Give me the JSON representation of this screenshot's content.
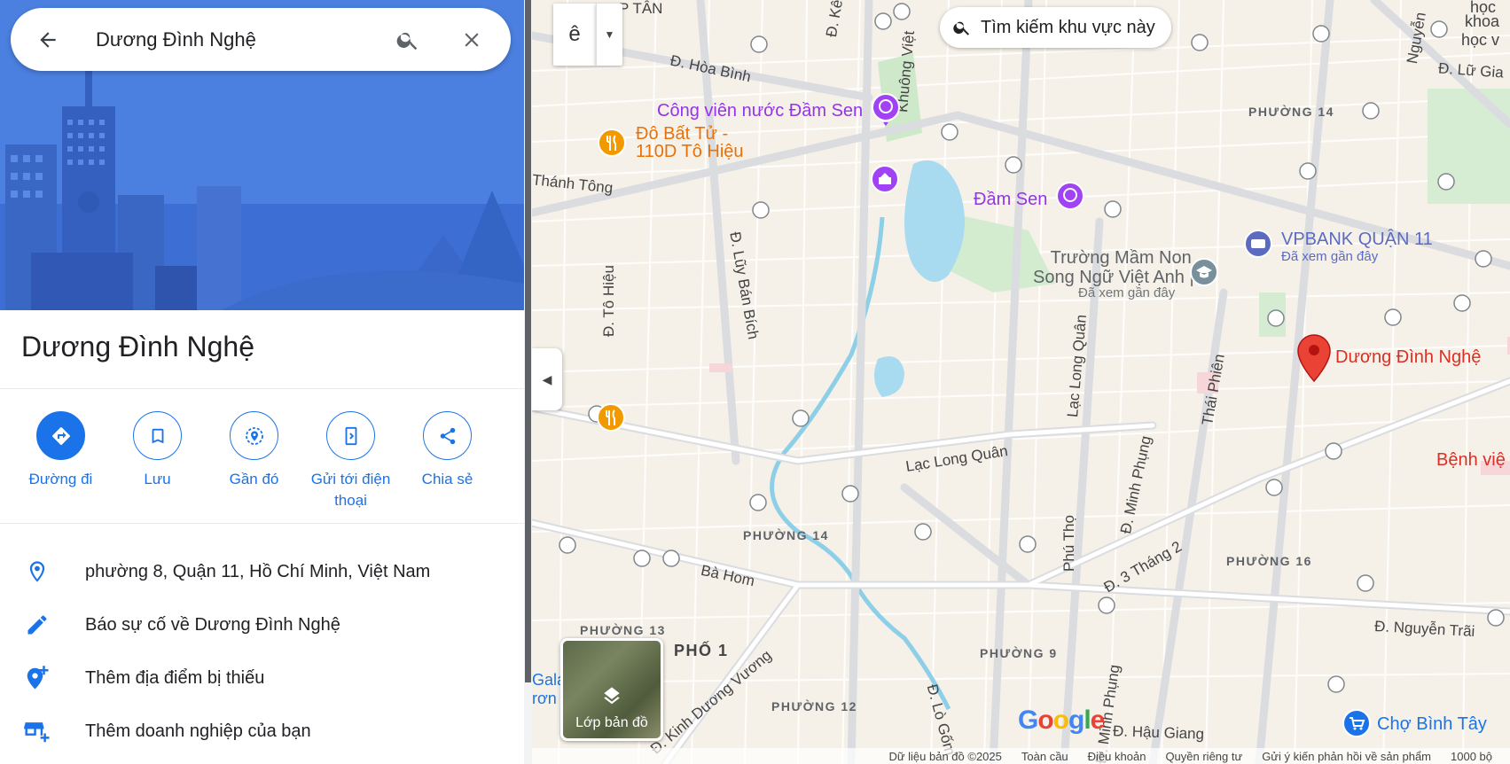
{
  "search": {
    "query": "Dương Đình Nghệ"
  },
  "place": {
    "title": "Dương Đình Nghệ"
  },
  "actions": [
    {
      "label": "Đường đi",
      "icon": "directions-icon"
    },
    {
      "label": "Lưu",
      "icon": "bookmark-icon"
    },
    {
      "label": "Gần đó",
      "icon": "nearby-icon"
    },
    {
      "label": "Gửi tới điện thoại",
      "icon": "send-to-phone-icon"
    },
    {
      "label": "Chia sẻ",
      "icon": "share-icon"
    }
  ],
  "info": {
    "address": "phường 8, Quận 11, Hồ Chí Minh, Việt Nam",
    "report": "Báo sự cố về Dương Đình Nghệ",
    "add_place": "Thêm địa điểm bị thiếu",
    "add_business": "Thêm doanh nghiệp của bạn"
  },
  "map": {
    "search_area": "Tìm kiếm khu vực này",
    "lang_char": "ê",
    "layers_label": "Lớp bản đồ",
    "selected_pin_label": "Dương Đình Nghệ",
    "pin_color": "#ea4335",
    "accent": "#1a73e8",
    "roads": {
      "hoa_binh": "Đ. Hòa Bình",
      "kenh_tan": "Đ. Kênh Tân",
      "khuong_viet": "Khuông Việt",
      "thanh_tong": "Thánh Tông",
      "to_hieu": "Đ. Tô Hiệu",
      "luy_ban_bich": "Đ. Lũy Bán Bích",
      "lac_long_quan_v": "Lạc Long Quân",
      "lac_long_quan_h": "Lạc Long Quân",
      "minh_phung": "Đ. Minh Phụng",
      "thai_phien": "Thái Phiên",
      "ba_thang_hai": "Đ. 3 Tháng 2",
      "ba_hom": "Bà Hom",
      "phu_tho": "Phú Thọ",
      "nguyen_trai": "Đ. Nguyễn Trãi",
      "hau_giang": "Đ. Hậu Giang",
      "lo_gom": "Đ. Lò Gốm",
      "kinh_duong_vuong": "Đ. Kinh Dương Vương",
      "minh_phung_2": "Đ. Minh Phụng",
      "lu_gia": "Đ. Lữ Gia",
      "nguyen": "Nguyễn",
      "p_tan": "P TÂN"
    },
    "wards": {
      "p14_top": "PHƯỜNG 14",
      "p14": "PHƯỜNG 14",
      "p16": "PHƯỜNG 16",
      "p13": "PHƯỜNG 13",
      "p9": "PHƯỜNG 9",
      "p12": "PHƯỜNG 12",
      "pho1": "PHỐ 1"
    },
    "pois": {
      "dam_sen_water_park": "Công viên nước Đầm Sen",
      "do_bat_tu_1": "Đô Bất Tử -",
      "do_bat_tu_2": "110D Tô Hiệu",
      "dam_sen": "Đầm Sen",
      "vpbank": "VPBANK QUẬN 11",
      "vpbank_sub": "Đã xem gần đây",
      "school_1": "Trường Mầm Non",
      "school_2": "Song Ngữ Việt Anh |...",
      "school_sub": "Đã xem gần đây",
      "benh_vien": "Bệnh việ",
      "cho_binh_tay": "Chợ Bình Tây",
      "gala": "Gala",
      "gala2": "rơn",
      "hoc_top": "học",
      "khoa_top": "khoa",
      "hoc2_top": "học v"
    },
    "google_logo": [
      "G",
      "o",
      "o",
      "g",
      "l",
      "e"
    ],
    "attribution": [
      "Dữ liệu bản đồ ©2025",
      "Toàn cầu",
      "Điều khoản",
      "Quyền riêng tư",
      "Gửi ý kiến phản hồi về sản phẩm",
      "1000 bộ"
    ]
  }
}
